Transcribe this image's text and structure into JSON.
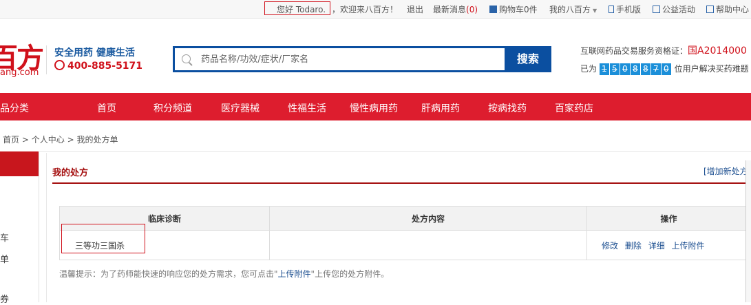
{
  "topbar": {
    "greeting": "您好 Todaro.",
    "welcome": "，欢迎来八百方！",
    "logout": "退出",
    "messages_label": "最新消息",
    "messages_count": "(0)",
    "cart": "购物车0件",
    "my_account": "我的八百方",
    "mobile": "手机版",
    "charity": "公益活动",
    "help": "帮助中心"
  },
  "header": {
    "logo_text": "百方",
    "logo_domain": "ang.com",
    "slogan": "安全用药 健康生活",
    "phone": "400-885-5171",
    "license_label": "互联网药品交易服务资格证：",
    "license_code": "国A2014000",
    "counter_prefix": "已为",
    "counter_digits": [
      "1",
      "5",
      "0",
      "8",
      "8",
      "7",
      "0"
    ],
    "counter_suffix": "位用户解决买药难题"
  },
  "search": {
    "placeholder": "药品名称/功效/症状/厂家名",
    "button": "搜索"
  },
  "nav": {
    "category": "品分类",
    "items": [
      "首页",
      "积分频道",
      "医疗器械",
      "性福生活",
      "慢性病用药",
      "肝病用药",
      "按病找药",
      "百家药店"
    ]
  },
  "breadcrumb": [
    "首页",
    "个人中心",
    "我的处方单"
  ],
  "sidebar": {
    "items": [
      "车",
      "单",
      "券"
    ]
  },
  "panel": {
    "title": "我的处方",
    "add_link": "[增加新处方"
  },
  "table": {
    "headers": [
      "临床诊断",
      "处方内容",
      "操作"
    ],
    "rows": [
      {
        "diagnosis": "三等功三国杀",
        "content": "",
        "actions": [
          "修改",
          "删除",
          "详细",
          "上传附件"
        ]
      }
    ]
  },
  "tip": {
    "prefix": "温馨提示：为了药师能快速的响应您的处方需求，您可点击\"",
    "link": "上传附件",
    "suffix": "\"上传您的处方附件。"
  },
  "colors": {
    "brand_red": "#dd1d2e",
    "brand_blue": "#0b4fa0",
    "link_blue": "#1a4d8f",
    "dark_red": "#a40e0e"
  }
}
